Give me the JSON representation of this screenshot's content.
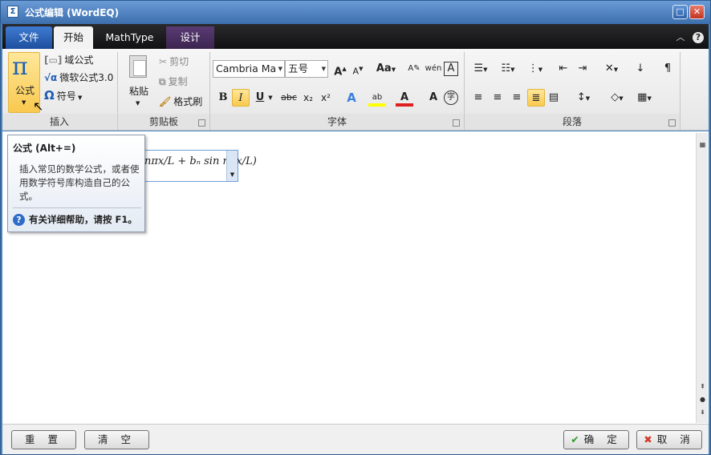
{
  "window": {
    "title": "公式编辑 (WordEQ)",
    "icon": "app-icon"
  },
  "tabs": {
    "file": "文件",
    "home": "开始",
    "mathtype": "MathType",
    "design": "设计"
  },
  "ribbon": {
    "insert": {
      "label": "插入",
      "equation": {
        "glyph": "π",
        "label": "公式"
      },
      "field_equation": "域公式",
      "ms_equation": "微软公式3.0",
      "symbol": "符号"
    },
    "clipboard": {
      "label": "剪贴板",
      "paste": "粘贴",
      "cut": "剪切",
      "copy": "复制",
      "format_painter": "格式刷"
    },
    "font": {
      "label": "字体",
      "font_name": "Cambria Ma",
      "font_size": "五号"
    },
    "paragraph": {
      "label": "段落"
    }
  },
  "equation": {
    "preview": "nπx/L + bₙ sin nπx/L)"
  },
  "tooltip": {
    "title": "公式 (Alt+=)",
    "description": "插入常见的数学公式，或者使用数学符号库构造自己的公式。",
    "help": "有关详细帮助，请按 F1。"
  },
  "footer": {
    "reset": "重 置",
    "clear": "清 空",
    "ok": "确 定",
    "cancel": "取 消"
  },
  "colors": {
    "accent": "#f9c94f",
    "titlebar": "#3d6fae",
    "tab_design": "#5a3b74"
  }
}
